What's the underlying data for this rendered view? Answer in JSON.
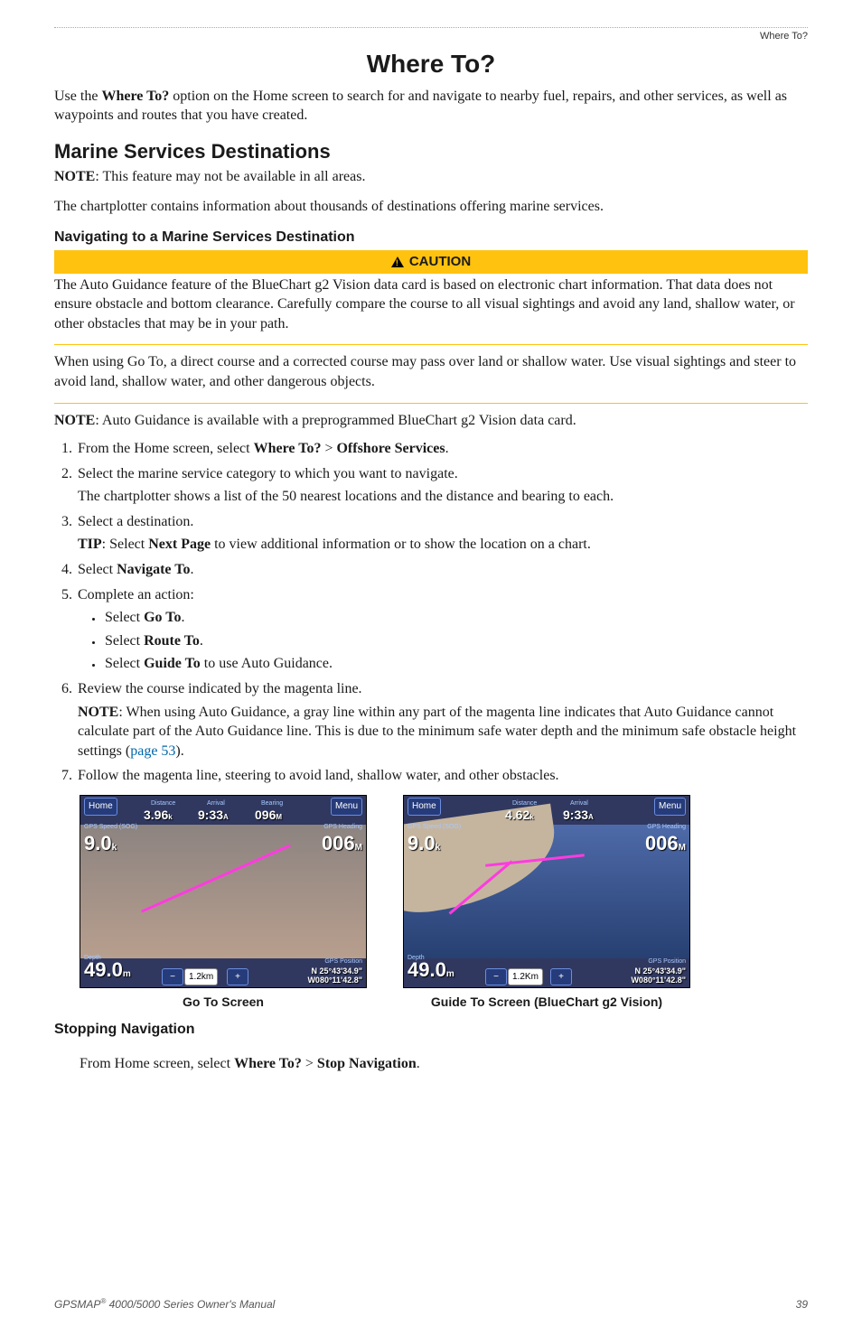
{
  "header": {
    "label": "Where To?"
  },
  "title": "Where To?",
  "intro": {
    "pre": "Use the ",
    "bold": "Where To?",
    "post": " option on the Home screen to search for and navigate to nearby fuel, repairs, and other services, as well as waypoints and routes that you have created."
  },
  "section1": {
    "heading": "Marine Services Destinations",
    "note_label": "NOTE",
    "note_text": ": This feature may not be available in all areas.",
    "para": "The chartplotter contains information about thousands of destinations offering marine services.",
    "sub_heading": "Navigating to a Marine Services Destination"
  },
  "caution": {
    "label": "CAUTION",
    "p1": "The Auto Guidance feature of the BlueChart g2 Vision data card is based on electronic chart information. That data does not ensure obstacle and bottom clearance. Carefully compare the course to all visual sightings and avoid any land, shallow water, or other obstacles that may be in your path.",
    "p2": "When using Go To, a direct course and a corrected course may pass over land or shallow water. Use visual sightings and steer to avoid land, shallow water, and other dangerous objects."
  },
  "post_caution": {
    "note_label": "NOTE",
    "note_text": ": Auto Guidance is available with a preprogrammed BlueChart g2 Vision data card."
  },
  "steps": {
    "s1": {
      "pre": "From the Home screen, select ",
      "b1": "Where To?",
      "mid": " > ",
      "b2": "Offshore Services",
      "post": "."
    },
    "s2": {
      "text": "Select the marine service category to which you want to navigate.",
      "sub": "The chartplotter shows a list of the 50 nearest locations and the distance and bearing to each."
    },
    "s3": {
      "text": "Select a destination.",
      "tip_label": "TIP",
      "tip_pre": ": Select ",
      "tip_bold": "Next Page",
      "tip_post": " to view additional information or to show the location on a chart."
    },
    "s4": {
      "pre": "Select ",
      "bold": "Navigate To",
      "post": "."
    },
    "s5": {
      "text": "Complete an action:",
      "a": {
        "pre": "Select ",
        "bold": "Go To",
        "post": "."
      },
      "b": {
        "pre": "Select ",
        "bold": "Route To",
        "post": "."
      },
      "c": {
        "pre": "Select ",
        "bold": "Guide To",
        "post": " to use Auto Guidance."
      }
    },
    "s6": {
      "text": "Review the course indicated by the magenta line.",
      "note_label": "NOTE",
      "note_text": ": When using Auto Guidance, a gray line within any part of the magenta line indicates that Auto Guidance cannot calculate part of the Auto Guidance line. This is due to the minimum safe water depth and the minimum safe obstacle height settings (",
      "link": "page 53",
      "note_end": ")."
    },
    "s7": "Follow the magenta line, steering to avoid land, shallow water, and other obstacles."
  },
  "figures": {
    "f1": {
      "caption": "Go To Screen",
      "home": "Home",
      "menu": "Menu",
      "distance_lbl": "Distance",
      "distance_val": "3.96",
      "distance_unit": "k",
      "arrival_lbl": "Arrival",
      "arrival_val": "9:33",
      "arrival_unit": "A",
      "bearing_lbl": "Bearing",
      "bearing_val": "096",
      "bearing_unit": "M",
      "sog_lbl": "GPS Speed (SOG)",
      "sog_val": "9.0",
      "sog_unit": "k",
      "heading_lbl": "GPS Heading",
      "heading_val": "006",
      "heading_unit": "M",
      "depth_lbl": "Depth",
      "depth_val": "49.0",
      "depth_unit": "m",
      "pos_lbl": "GPS Position",
      "pos_lat": "N 25°43'34.9\"",
      "pos_lon": "W080°11'42.8\"",
      "scale": "1.2km"
    },
    "f2": {
      "caption": "Guide To Screen (BlueChart g2 Vision)",
      "home": "Home",
      "menu": "Menu",
      "distance_lbl": "Distance",
      "distance_val": "4.62",
      "distance_unit": "k",
      "arrival_lbl": "Arrival",
      "arrival_val": "9:33",
      "arrival_unit": "A",
      "sog_lbl": "GPS Speed (SOG)",
      "sog_val": "9.0",
      "sog_unit": "k",
      "heading_lbl": "GPS Heading",
      "heading_val": "006",
      "heading_unit": "M",
      "depth_lbl": "Depth",
      "depth_val": "49.0",
      "depth_unit": "m",
      "pos_lbl": "GPS Position",
      "pos_lat": "N 25°43'34.9\"",
      "pos_lon": "W080°11'42.8\"",
      "scale": "1.2Km"
    }
  },
  "stopping": {
    "heading": "Stopping Navigation",
    "pre": "From Home screen, select ",
    "b1": "Where To?",
    "mid": " > ",
    "b2": "Stop Navigation",
    "post": "."
  },
  "footer": {
    "left_pre": "GPSMAP",
    "left_reg": "®",
    "left_post": " 4000/5000 Series Owner's Manual",
    "page": "39"
  }
}
